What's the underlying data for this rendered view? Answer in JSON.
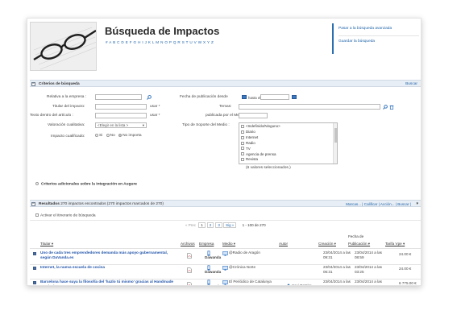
{
  "header": {
    "title": "Búsqueda de Impactos",
    "letters": "# A B C D E F G H I J K L M N O P Q R S T U V W X Y Z",
    "links": [
      "Pasar a la búsqueda avanzada",
      "Guardar la búsqueda"
    ]
  },
  "criteria": {
    "section_title": "Criterios de búsqueda",
    "search_label": "Buscar",
    "fields": {
      "empresa": "Relativa a la empresa :",
      "titular": "Titular del impacto:",
      "texto": "Texto dentro del artículo :",
      "valoracion": "Valoración cualitativa:",
      "cualificado": "Impacto cualificado:",
      "fecha": "Fecha de publicación desde",
      "hasta": "hasta el",
      "temas": "Temas:",
      "publicada": "publicada por el Medio :",
      "soporte": "Tipo de Soporte del Medio :"
    },
    "usar_label": "usar *",
    "valoracion_value": "<Elegir en la lista >",
    "cualificado_options": [
      "Si",
      "No",
      "No importa"
    ],
    "cualificado_selected": "No importa",
    "soporte_options": [
      "<Indefinido/Ninguno>",
      "Diario",
      "Internet",
      "Radio",
      "TV",
      "Agencia de prensa",
      "Revista"
    ],
    "soporte_footer": "(6 valores seleccionados.)",
    "adicionales": "Criterios adicionales sobre la integración en Augure"
  },
  "results": {
    "section_title": "Resultados",
    "summary": "270 impactos encontrados (270 impactos marcados de 270)",
    "actions": "Marcas... | Calificar | Acción... | Buscar |",
    "itinerario": "Activar el itinerario de búsqueda",
    "pager": {
      "prev": "« Prec",
      "pages": [
        "1",
        "2",
        "3"
      ],
      "next": "Sig »",
      "range": "1 - 100 de 270"
    },
    "columns": {
      "titular": "Titular",
      "archivos": "Archivos",
      "empresa": "Empresa",
      "medio": "Medio",
      "autor": "Autor",
      "creacion": "Creación",
      "fecha_top": "Fecha de",
      "publicacion": "Publicación",
      "tarifa": "Tarifa Vpe"
    },
    "rows": [
      {
        "title": "Uno de cada tres emprendedores demanda más apoyo gubernamental, según DaVanda.es",
        "empresa": "Dawanda",
        "medio": "@Radio de Aragón",
        "autor": "",
        "creacion": "23/04/2014 a las 09:31",
        "publicacion": "23/04/2014 a las 08:59",
        "tarifa": "24.00 €"
      },
      {
        "title": "Internet, la nueva escuela de cocina",
        "empresa": "Dawanda",
        "medio": "@Crónica Norte",
        "autor": "",
        "creacion": "23/04/2014 a las 06:31",
        "publicacion": "23/04/2014 a las 03:25",
        "tarifa": "24.00 €"
      },
      {
        "title": "Barcelona hace suya la filosofía del 'hazlo tú mismo' gracias al Handmade Festival",
        "empresa": "Dawanda",
        "medio": "El Periódico de Catalunya",
        "autor": "Xavi Datzira",
        "creacion": "23/04/2014 a las 06:31",
        "publicacion": "23/04/2014 a las 01:46",
        "tarifa": "6 775.00 €"
      }
    ]
  },
  "colors": {
    "accent": "#2266aa",
    "bar": "#e8eef5",
    "calendar": "#3a78c0"
  }
}
